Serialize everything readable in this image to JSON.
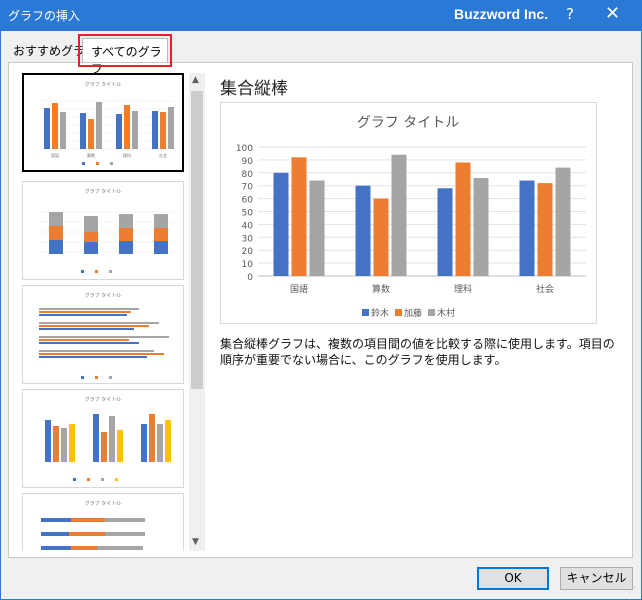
{
  "window": {
    "title": "グラフの挿入",
    "brand": "Buzzword Inc.",
    "help": "?",
    "close": "✕"
  },
  "tabs": {
    "recommended": "おすすめグラフ",
    "all": "すべてのグラフ"
  },
  "thumbnails": {
    "title": "グラフ タイトル",
    "categories": [
      "国語",
      "算数",
      "理科",
      "社会"
    ],
    "legend": [
      "鈴木",
      "加藤",
      "木村"
    ]
  },
  "preview": {
    "chart_name": "集合縦棒",
    "description": "集合縦棒グラフは、複数の項目間の値を比較する際に使用します。項目の順序が重要でない場合に、このグラフを使用します。"
  },
  "chart_data": {
    "type": "bar",
    "title": "グラフ タイトル",
    "categories": [
      "国語",
      "算数",
      "理科",
      "社会"
    ],
    "series": [
      {
        "name": "鈴木",
        "values": [
          80,
          70,
          68,
          74
        ],
        "color": "#4472c4"
      },
      {
        "name": "加藤",
        "values": [
          92,
          60,
          88,
          72
        ],
        "color": "#ed7d31"
      },
      {
        "name": "木村",
        "values": [
          74,
          94,
          76,
          84
        ],
        "color": "#a5a5a5"
      }
    ],
    "yticks": [
      0,
      10,
      20,
      30,
      40,
      50,
      60,
      70,
      80,
      90,
      100
    ],
    "ylim": [
      0,
      100
    ],
    "grid": true,
    "legend_position": "bottom"
  },
  "buttons": {
    "ok": "OK",
    "cancel": "キャンセル"
  },
  "scroll": {
    "up": "▲",
    "down": "▼"
  }
}
